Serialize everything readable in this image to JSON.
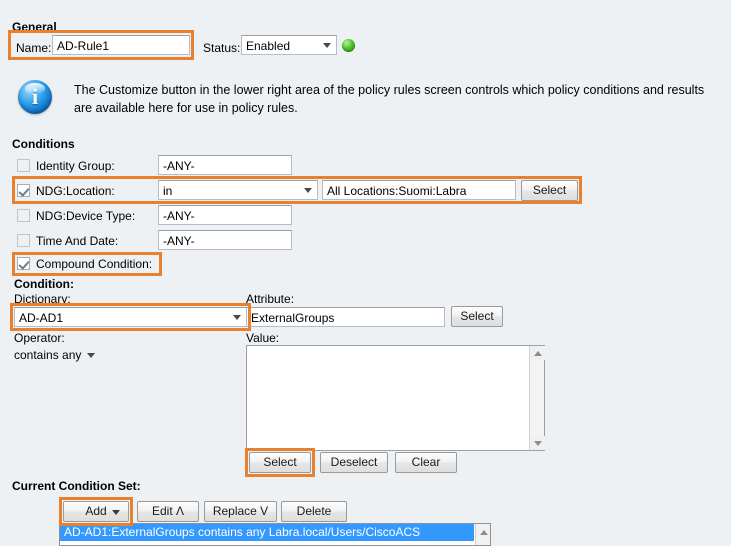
{
  "sections": {
    "general": "General",
    "conditions": "Conditions",
    "condition": "Condition:",
    "current_condition_set": "Current Condition Set:"
  },
  "general": {
    "name_label": "Name:",
    "name_value": "AD-Rule1",
    "status_label": "Status:",
    "status_value": "Enabled",
    "status_led": "green-status-indicator"
  },
  "info_banner": {
    "icon": "info-icon",
    "text": "The Customize button in the lower right area of the policy rules screen controls which policy conditions and results are available here for use in policy rules."
  },
  "conditions": {
    "rows": [
      {
        "label": "Identity Group:",
        "checked": false,
        "value": "-ANY-",
        "type": "text"
      },
      {
        "label": "NDG:Location:",
        "checked": true,
        "value": "in",
        "type": "select"
      },
      {
        "label": "NDG:Device Type:",
        "checked": false,
        "value": "-ANY-",
        "type": "text"
      },
      {
        "label": "Time And Date:",
        "checked": false,
        "value": "-ANY-",
        "type": "text"
      }
    ],
    "location_value": "All Locations:Suomi:Labra",
    "location_select_button": "Select",
    "compound_condition_label": "Compound Condition:",
    "compound_condition_checked": true
  },
  "condition": {
    "dictionary_label": "Dictionary:",
    "dictionary_value": "AD-AD1",
    "attribute_label": "Attribute:",
    "attribute_value": "ExternalGroups",
    "attribute_select_button": "Select",
    "operator_label": "Operator:",
    "operator_value": "contains any",
    "value_label": "Value:",
    "value_content": "",
    "buttons": {
      "select": "Select",
      "deselect": "Deselect",
      "clear": "Clear"
    }
  },
  "current_condition_set": {
    "buttons": {
      "add": "Add",
      "edit": "Edit Λ",
      "replace": "Replace V",
      "delete": "Delete"
    },
    "items": [
      "AD-AD1:ExternalGroups contains any Labra.local/Users/CiscoACS"
    ]
  },
  "colors": {
    "highlight": "#e8802e",
    "selection": "#3399ff",
    "background": "#eef1f3",
    "status_green": "#4fc52a"
  }
}
